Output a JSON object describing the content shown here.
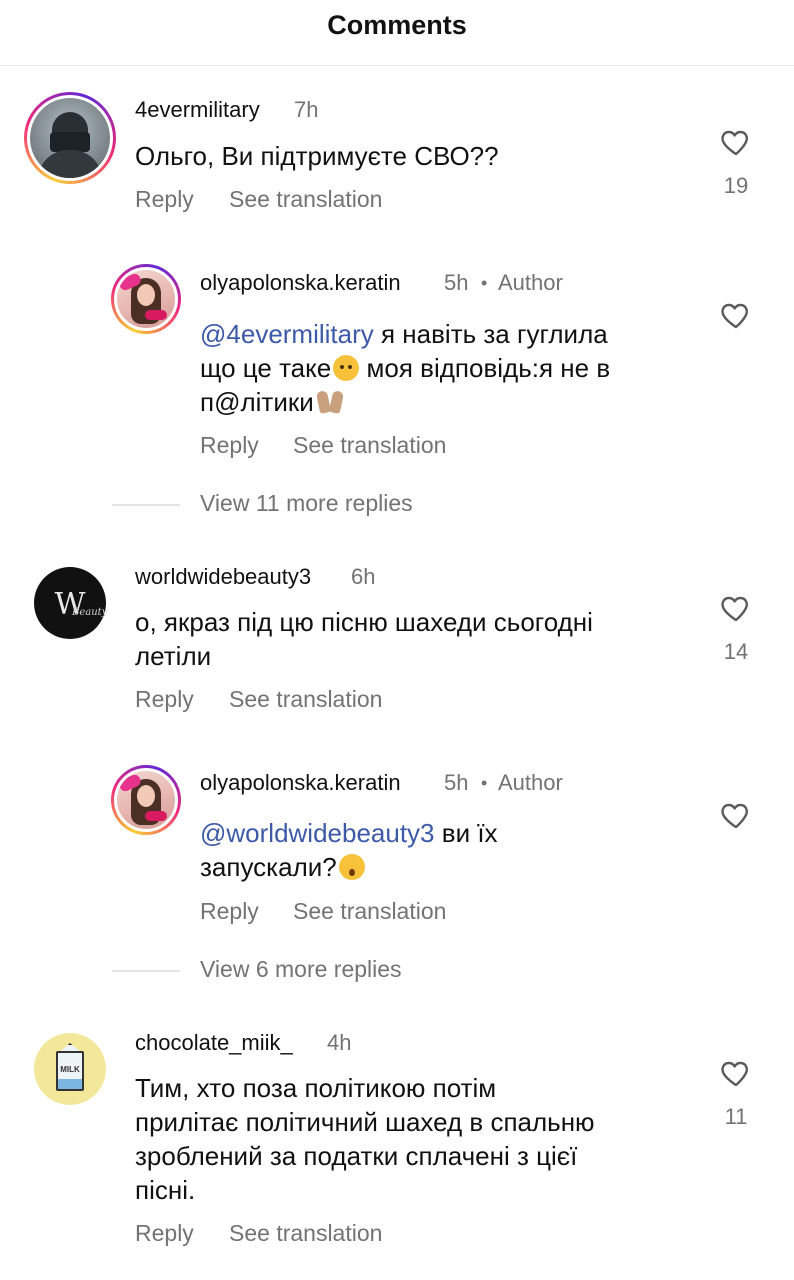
{
  "header": {
    "title": "Comments"
  },
  "actions": {
    "reply": "Reply",
    "see_translation": "See translation"
  },
  "comments": [
    {
      "username": "4evermilitary",
      "time": "7h",
      "text": "Ольго, Ви підтримуєте СВО??",
      "likes": "19",
      "replies": [
        {
          "username": "olyapolonska.keratin",
          "time": "5h",
          "author_label": "Author",
          "mention": "@4evermilitary",
          "text_1": " я навіть за гуглила",
          "text_2": "що це таке",
          "text_3": " моя відповідь:я не в",
          "text_4": "п@літики"
        }
      ],
      "view_more": "View 11 more replies"
    },
    {
      "username": "worldwidebeauty3",
      "time": "6h",
      "text_1": "о, якраз під цю пісню шахеди сьогодні",
      "text_2": "летіли",
      "likes": "14",
      "replies": [
        {
          "username": "olyapolonska.keratin",
          "time": "5h",
          "author_label": "Author",
          "mention": "@worldwidebeauty3",
          "text_1": " ви їх",
          "text_2": "запускали?"
        }
      ],
      "view_more": "View 6 more replies"
    },
    {
      "username": "chocolate_miik_",
      "time": "4h",
      "text_1": "Тим, хто поза політикою потім",
      "text_2": "прилітає політичний шахед в спальню",
      "text_3": "зроблений за податки сплачені з цієї",
      "text_4": "пісні.",
      "likes": "11",
      "avatar_label": "MILK"
    }
  ],
  "icons": {
    "like": "heart-outline-icon"
  },
  "colors": {
    "mention": "#3d5aa8",
    "secondary_text": "#737373"
  }
}
